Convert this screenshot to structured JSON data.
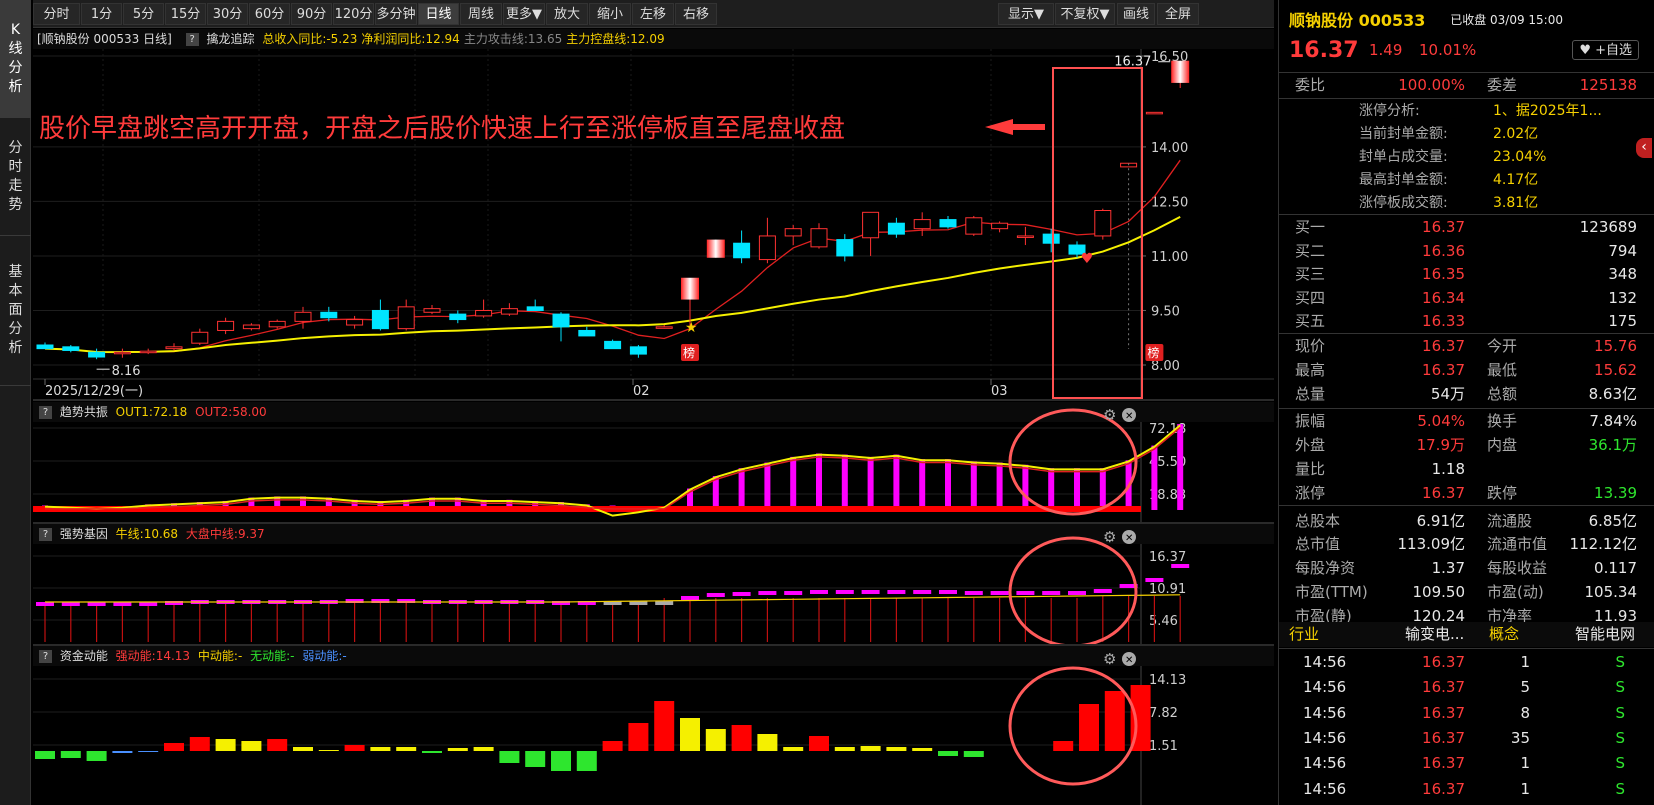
{
  "left_tabs": [
    {
      "label": "K线分析",
      "active": true
    },
    {
      "label": "分时走势",
      "active": false
    },
    {
      "label": "基本面分析",
      "active": false
    }
  ],
  "toolbar": {
    "periods": [
      {
        "label": "分时"
      },
      {
        "label": "1分"
      },
      {
        "label": "5分"
      },
      {
        "label": "15分"
      },
      {
        "label": "30分"
      },
      {
        "label": "60分"
      },
      {
        "label": "90分"
      },
      {
        "label": "120分"
      },
      {
        "label": "多分钟"
      },
      {
        "label": "日线",
        "active": true
      },
      {
        "label": "周线"
      },
      {
        "label": "更多▼"
      },
      {
        "label": "放大"
      },
      {
        "label": "缩小"
      },
      {
        "label": "左移"
      },
      {
        "label": "右移"
      }
    ],
    "right_buttons": [
      {
        "label": "显示▼"
      },
      {
        "label": "不复权▼"
      },
      {
        "label": "画线"
      },
      {
        "label": "全屏"
      }
    ]
  },
  "main_info": {
    "title": "[顺钠股份 000533 日线]",
    "indicator": "擒龙追踪",
    "items": [
      {
        "text": "总收入同比:-5.23",
        "color": "#f5d000"
      },
      {
        "text": "净利润同比:12.94",
        "color": "#f5d000"
      },
      {
        "text": "主力攻击线:13.65",
        "color": "#888888"
      },
      {
        "text": "主力控盘线:12.09",
        "color": "#f5d000"
      }
    ]
  },
  "annotation": {
    "text": "股价早盘跳空高开开盘，开盘之后股价快速上行至涨停板直至尾盘收盘",
    "color": "#ff3b3b"
  },
  "main_chart": {
    "y_labels": [
      "16.50",
      "14.00",
      "12.50",
      "11.00",
      "9.50",
      "8.00"
    ],
    "x_labels": [
      "2025/12/29(一)",
      "02",
      "03"
    ],
    "high_label": "16.37",
    "low_label": "8.16",
    "badge": "榜",
    "candles": [
      {
        "o": 8.55,
        "h": 8.62,
        "l": 8.48,
        "c": 8.45
      },
      {
        "o": 8.5,
        "h": 8.55,
        "l": 8.35,
        "c": 8.4
      },
      {
        "o": 8.35,
        "h": 8.45,
        "l": 8.16,
        "c": 8.22
      },
      {
        "o": 8.35,
        "h": 8.45,
        "l": 8.2,
        "c": 8.35
      },
      {
        "o": 8.38,
        "h": 8.45,
        "l": 8.3,
        "c": 8.38
      },
      {
        "o": 8.45,
        "h": 8.6,
        "l": 8.4,
        "c": 8.5
      },
      {
        "o": 8.6,
        "h": 9.0,
        "l": 8.55,
        "c": 8.9
      },
      {
        "o": 8.95,
        "h": 9.3,
        "l": 8.85,
        "c": 9.2
      },
      {
        "o": 9.0,
        "h": 9.15,
        "l": 8.95,
        "c": 9.1
      },
      {
        "o": 9.05,
        "h": 9.25,
        "l": 9.0,
        "c": 9.2
      },
      {
        "o": 9.2,
        "h": 9.6,
        "l": 9.0,
        "c": 9.45
      },
      {
        "o": 9.45,
        "h": 9.6,
        "l": 9.2,
        "c": 9.3
      },
      {
        "o": 9.1,
        "h": 9.35,
        "l": 9.0,
        "c": 9.25
      },
      {
        "o": 9.5,
        "h": 9.8,
        "l": 8.95,
        "c": 9.0
      },
      {
        "o": 9.0,
        "h": 9.8,
        "l": 8.95,
        "c": 9.6
      },
      {
        "o": 9.45,
        "h": 9.65,
        "l": 9.4,
        "c": 9.55
      },
      {
        "o": 9.4,
        "h": 9.5,
        "l": 9.15,
        "c": 9.25
      },
      {
        "o": 9.35,
        "h": 9.8,
        "l": 9.3,
        "c": 9.5
      },
      {
        "o": 9.4,
        "h": 9.7,
        "l": 9.35,
        "c": 9.55
      },
      {
        "o": 9.6,
        "h": 9.8,
        "l": 9.5,
        "c": 9.5
      },
      {
        "o": 9.4,
        "h": 9.45,
        "l": 8.65,
        "c": 9.05
      },
      {
        "o": 8.95,
        "h": 9.05,
        "l": 8.8,
        "c": 8.8
      },
      {
        "o": 8.65,
        "h": 8.7,
        "l": 8.45,
        "c": 8.45
      },
      {
        "o": 8.5,
        "h": 8.55,
        "l": 8.2,
        "c": 8.3
      },
      {
        "o": 9.05,
        "h": 9.1,
        "l": 9.0,
        "c": 9.05
      },
      {
        "o": 9.8,
        "h": 10.3,
        "l": 9.05,
        "c": 10.4
      },
      {
        "o": 10.95,
        "h": 11.45,
        "l": 10.95,
        "c": 11.45
      },
      {
        "o": 11.35,
        "h": 11.7,
        "l": 10.8,
        "c": 10.95
      },
      {
        "o": 10.9,
        "h": 12.05,
        "l": 10.8,
        "c": 11.55
      },
      {
        "o": 11.55,
        "h": 11.85,
        "l": 11.3,
        "c": 11.75
      },
      {
        "o": 11.25,
        "h": 11.9,
        "l": 11.2,
        "c": 11.75
      },
      {
        "o": 11.45,
        "h": 11.6,
        "l": 10.85,
        "c": 11.0
      },
      {
        "o": 11.5,
        "h": 12.2,
        "l": 11.0,
        "c": 12.2
      },
      {
        "o": 11.9,
        "h": 12.05,
        "l": 11.5,
        "c": 11.6
      },
      {
        "o": 11.75,
        "h": 12.2,
        "l": 11.55,
        "c": 12.0
      },
      {
        "o": 12.0,
        "h": 12.1,
        "l": 11.75,
        "c": 11.8
      },
      {
        "o": 11.6,
        "h": 12.1,
        "l": 11.55,
        "c": 12.05
      },
      {
        "o": 11.75,
        "h": 11.95,
        "l": 11.65,
        "c": 11.9
      },
      {
        "o": 11.55,
        "h": 11.8,
        "l": 11.3,
        "c": 11.55
      },
      {
        "o": 11.6,
        "h": 11.75,
        "l": 11.1,
        "c": 11.35
      },
      {
        "o": 11.3,
        "h": 11.4,
        "l": 10.95,
        "c": 11.05
      },
      {
        "o": 11.55,
        "h": 12.3,
        "l": 11.45,
        "c": 12.25
      },
      {
        "o": 13.45,
        "h": 13.55,
        "l": 13.45,
        "c": 13.55
      },
      {
        "o": 14.95,
        "h": 14.95,
        "l": 14.95,
        "c": 14.95
      },
      {
        "o": 15.76,
        "h": 16.37,
        "l": 15.62,
        "c": 16.37
      }
    ]
  },
  "ind1": {
    "title": "趋势共振",
    "out1": "OUT1:72.18",
    "out2": "OUT2:58.00",
    "y_labels": [
      "72.18",
      "45.50",
      "18.83"
    ]
  },
  "ind2": {
    "title": "强势基因",
    "niu": "牛线:10.68",
    "dapan": "大盘中线:9.37",
    "y_labels": [
      "16.37",
      "10.91",
      "5.46"
    ]
  },
  "ind3": {
    "title": "资金动能",
    "strong": "强动能:14.13",
    "mid": "中动能:-",
    "none": "无动能:-",
    "weak": "弱动能:-",
    "y_labels": [
      "14.13",
      "7.82",
      "1.51"
    ]
  },
  "right": {
    "name": "顺钠股份",
    "code": "000533",
    "status": "已收盘",
    "date": "03/09 15:00",
    "price": "16.37",
    "change": "1.49",
    "pct": "10.01%",
    "add_label": "+自选",
    "weibi_label": "委比",
    "weibi": "100.00%",
    "weicha_label": "委差",
    "weicha": "125138",
    "zt_analysis": [
      {
        "label": "涨停分析:",
        "value": "1、据2025年1..."
      },
      {
        "label": "当前封单金额:",
        "value": "2.02亿"
      },
      {
        "label": "封单占成交量:",
        "value": "23.04%"
      },
      {
        "label": "最高封单金额:",
        "value": "4.17亿"
      },
      {
        "label": "涨停板成交额:",
        "value": "3.81亿"
      }
    ],
    "bids": [
      {
        "label": "买一",
        "price": "16.37",
        "vol": "123689"
      },
      {
        "label": "买二",
        "price": "16.36",
        "vol": "794"
      },
      {
        "label": "买三",
        "price": "16.35",
        "vol": "348"
      },
      {
        "label": "买四",
        "price": "16.34",
        "vol": "132"
      },
      {
        "label": "买五",
        "price": "16.33",
        "vol": "175"
      }
    ],
    "stats": [
      {
        "l1": "现价",
        "v1": "16.37",
        "c1": "red",
        "l2": "今开",
        "v2": "15.76",
        "c2": "red"
      },
      {
        "l1": "最高",
        "v1": "16.37",
        "c1": "red",
        "l2": "最低",
        "v2": "15.62",
        "c2": "red"
      },
      {
        "l1": "总量",
        "v1": "54万",
        "c1": "white",
        "l2": "总额",
        "v2": "8.63亿",
        "c2": "white"
      },
      {
        "l1": "振幅",
        "v1": "5.04%",
        "c1": "red",
        "l2": "换手",
        "v2": "7.84%",
        "c2": "white"
      },
      {
        "l1": "外盘",
        "v1": "17.9万",
        "c1": "red",
        "l2": "内盘",
        "v2": "36.1万",
        "c2": "green"
      },
      {
        "l1": "量比",
        "v1": "1.18",
        "c1": "white",
        "l2": "",
        "v2": "",
        "c2": "white"
      },
      {
        "l1": "涨停",
        "v1": "16.37",
        "c1": "red",
        "l2": "跌停",
        "v2": "13.39",
        "c2": "green"
      },
      {
        "l1": "总股本",
        "v1": "6.91亿",
        "c1": "white",
        "l2": "流通股",
        "v2": "6.85亿",
        "c2": "white"
      },
      {
        "l1": "总市值",
        "v1": "113.09亿",
        "c1": "white",
        "l2": "流通市值",
        "v2": "112.12亿",
        "c2": "white"
      },
      {
        "l1": "每股净资",
        "v1": "1.37",
        "c1": "white",
        "l2": "每股收益",
        "v2": "0.117",
        "c2": "white"
      },
      {
        "l1": "市盈(TTM)",
        "v1": "109.50",
        "c1": "white",
        "l2": "市盈(动)",
        "v2": "105.34",
        "c2": "white"
      },
      {
        "l1": "市盈(静)",
        "v1": "120.24",
        "c1": "white",
        "l2": "市净率",
        "v2": "11.93",
        "c2": "white"
      }
    ],
    "industry_label": "行业",
    "industry": "输变电...",
    "concept_label": "概念",
    "concept": "智能电网",
    "ticks": [
      {
        "time": "14:56",
        "price": "16.37",
        "vol": "1",
        "side": "S"
      },
      {
        "time": "14:56",
        "price": "16.37",
        "vol": "5",
        "side": "S"
      },
      {
        "time": "14:56",
        "price": "16.37",
        "vol": "8",
        "side": "S"
      },
      {
        "time": "14:56",
        "price": "16.37",
        "vol": "35",
        "side": "S"
      },
      {
        "time": "14:56",
        "price": "16.37",
        "vol": "1",
        "side": "S"
      },
      {
        "time": "14:56",
        "price": "16.37",
        "vol": "1",
        "side": "S"
      }
    ]
  }
}
